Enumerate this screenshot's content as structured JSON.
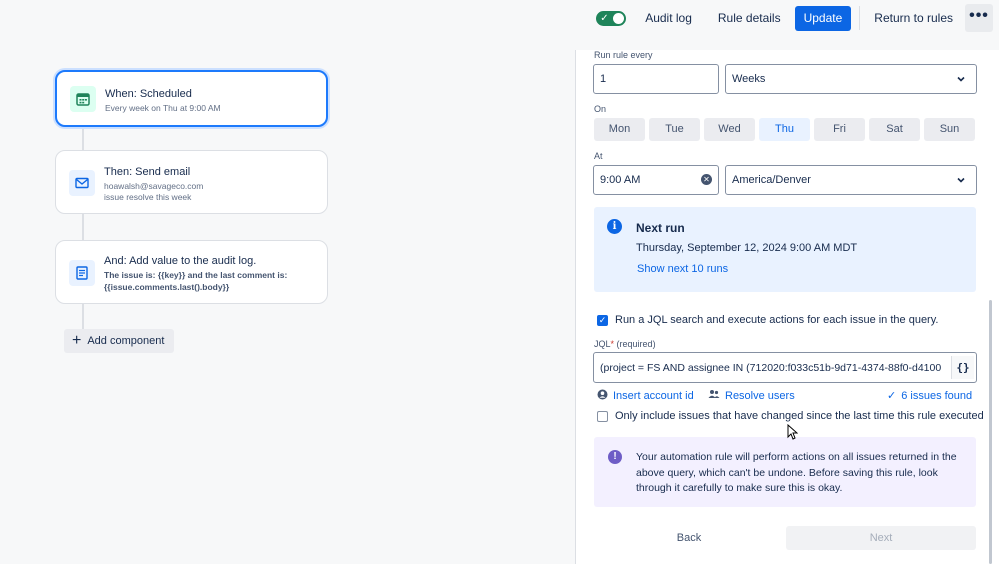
{
  "topbar": {
    "toggle_state": "on",
    "audit_log": "Audit log",
    "rule_details": "Rule details",
    "update": "Update",
    "return_to_rules": "Return to rules",
    "more": "•••"
  },
  "flow": {
    "trigger": {
      "title": "When: Scheduled",
      "sub": "Every week on Thu at 9:00 AM",
      "icon": "calendar-icon"
    },
    "action_email": {
      "title": "Then: Send email",
      "sub1": "hoawalsh@savageco.com",
      "sub2": "issue resolve this week",
      "icon": "mail-icon"
    },
    "action_audit": {
      "title": "And: Add value to the audit log.",
      "sub1": "The issue is: {{key}} and the last comment is:",
      "sub2": "{{issue.comments.last().body}}",
      "icon": "document-icon"
    },
    "add_component": "Add component"
  },
  "form": {
    "run_every_label": "Run rule every",
    "run_every_value": "1",
    "period_value": "Weeks",
    "on_label": "On",
    "days": [
      "Mon",
      "Tue",
      "Wed",
      "Thu",
      "Fri",
      "Sat",
      "Sun"
    ],
    "selected_day": "Thu",
    "at_label": "At",
    "time_value": "9:00 AM",
    "timezone_value": "America/Denver",
    "next_run": {
      "heading": "Next run",
      "datetime": "Thursday, September 12, 2024 9:00 AM MDT",
      "show_more": "Show next 10 runs"
    },
    "jql_check_label": "Run a JQL search and execute actions for each issue in the query.",
    "jql_label": "JQL",
    "jql_required": "(required)",
    "jql_value": "(project = FS AND assignee IN (712020:f033c51b-9d71-4374-88f0-d4100",
    "jql_braces": "{}",
    "insert_account_id": "Insert account id",
    "resolve_users": "Resolve users",
    "issues_found": "6 issues found",
    "only_changed_label": "Only include issues that have changed since the last time this rule executed",
    "warning": "Your automation rule will perform actions on all issues returned in the above query, which can't be undone. Before saving this rule, look through it carefully to make sure this is okay.",
    "back": "Back",
    "next": "Next"
  },
  "colors": {
    "primary": "#0c66e4",
    "toggle_on": "#1f845a",
    "info_bg": "#e9f2ff",
    "warning_bg": "#f3f0ff",
    "discovery_icon": "#6e5dc6"
  }
}
